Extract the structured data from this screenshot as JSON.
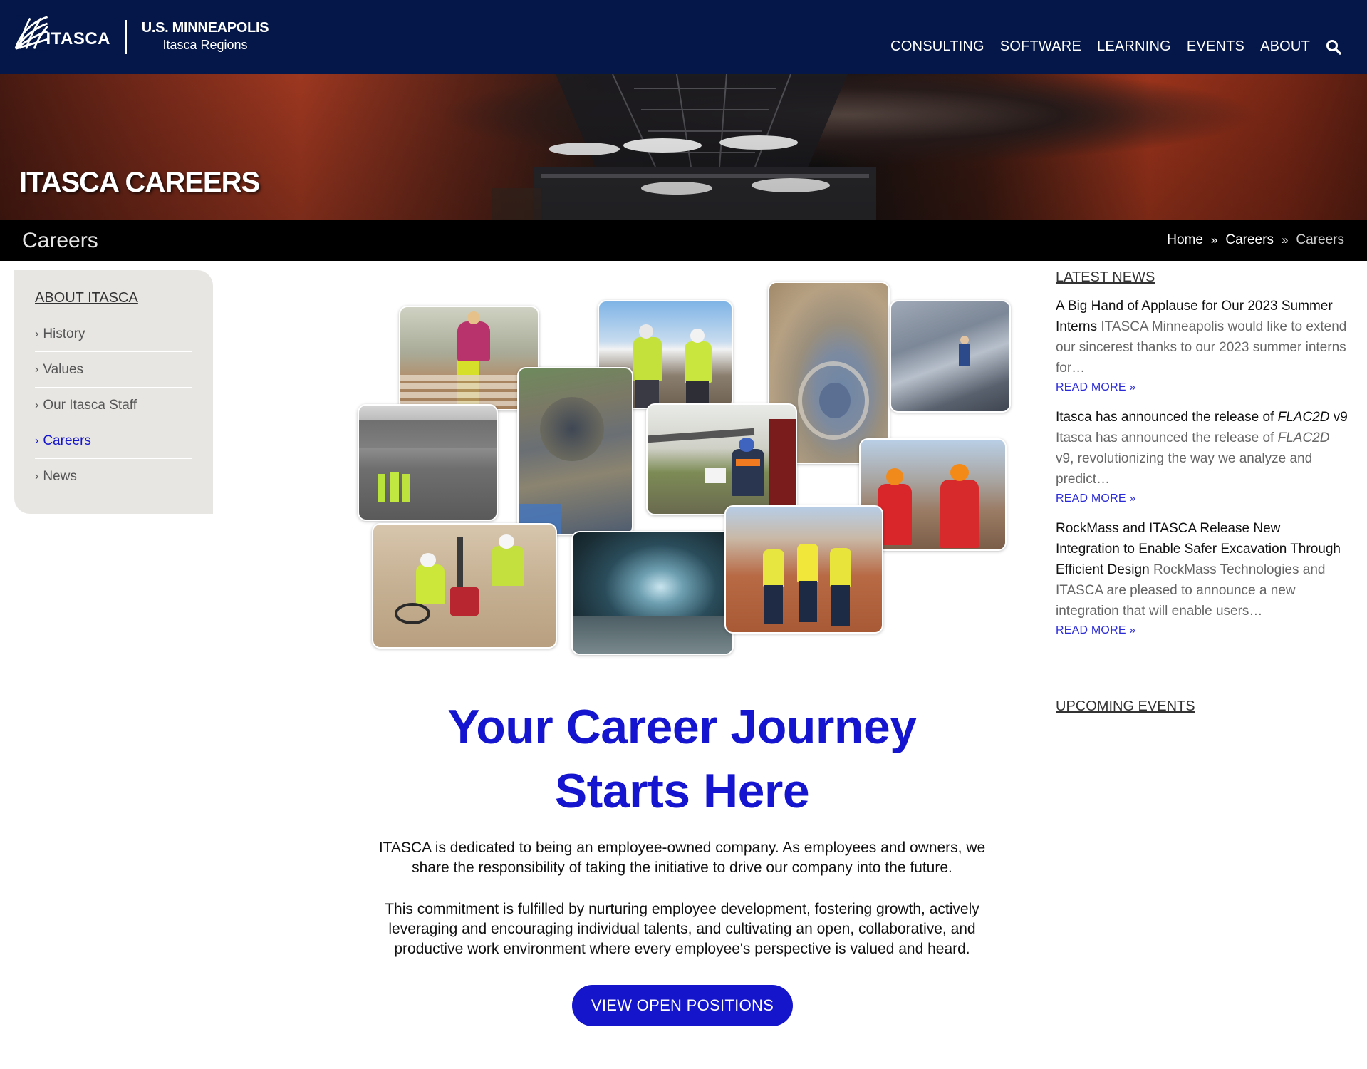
{
  "header": {
    "logo_text": "ITASCA",
    "region_title": "U.S. MINNEAPOLIS",
    "region_sub": "Itasca Regions",
    "nav": [
      "CONSULTING",
      "SOFTWARE",
      "LEARNING",
      "EVENTS",
      "ABOUT"
    ],
    "search_icon": "search-icon"
  },
  "hero": {
    "title": "ITASCA CAREERS"
  },
  "crumbbar": {
    "title": "Careers",
    "breadcrumb": [
      "Home",
      "Careers",
      "Careers"
    ]
  },
  "sidebar": {
    "heading": "ABOUT ITASCA",
    "items": [
      {
        "label": "History"
      },
      {
        "label": "Values"
      },
      {
        "label": "Our Itasca Staff"
      },
      {
        "label": "Careers"
      },
      {
        "label": "News"
      }
    ],
    "active_color": "#1515cc"
  },
  "main": {
    "headline_line1": "Your Career Journey",
    "headline_line2": "Starts Here",
    "paragraph1": "ITASCA is dedicated to being an employee-owned company. As employees and owners, we share the responsibility of taking the initiative to drive our company into the future.",
    "paragraph2": "This commitment is fulfilled by nurturing employee development, fostering growth, actively leveraging and encouraging individual talents, and cultivating an open, collaborative, and productive work environment where every employee's perspective is valued and heard.",
    "cta_label": "VIEW OPEN POSITIONS"
  },
  "right": {
    "news_heading": "LATEST NEWS",
    "news": [
      {
        "title": "A Big Hand of Applause for Our 2023 Summer Interns",
        "excerpt": "ITASCA Minneapolis would like to extend our sincerest thanks to our 2023 summer interns for…",
        "read_more": "READ MORE »"
      },
      {
        "title_pre": "Itasca has announced the release of ",
        "title_em": "FLAC2D",
        "title_post": " v9",
        "excerpt_pre": "Itasca has announced the release of ",
        "excerpt_em": "FLAC2D",
        "excerpt_post": " v9, revolutionizing the way we analyze and predict…",
        "read_more": "READ MORE »"
      },
      {
        "title": "RockMass and ITASCA Release New Integration to Enable Safer Excavation Through Efficient Design",
        "excerpt": "RockMass Technologies and ITASCA are pleased to announce a new integration that will enable users…",
        "read_more": "READ MORE »"
      }
    ],
    "events_heading": "UPCOMING EVENTS"
  },
  "colors": {
    "header_bg": "#041748",
    "accent_blue": "#1515cc",
    "sidebar_bg": "#e8e6e3",
    "crumbbar_bg": "#000000"
  }
}
